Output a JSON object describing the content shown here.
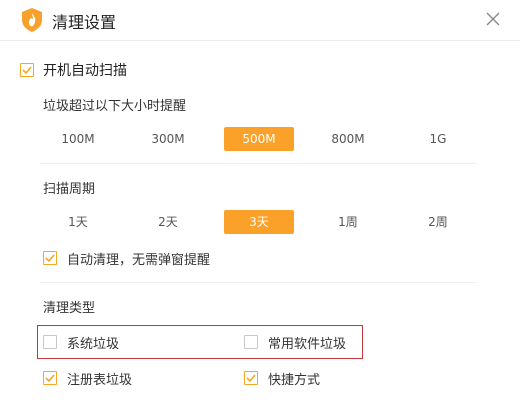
{
  "window": {
    "title": "清理设置",
    "logo_icon": "shield-logo-icon",
    "close_icon": "close-icon"
  },
  "colors": {
    "accent": "#fba129",
    "highlight_border": "#c6343b"
  },
  "auto_scan": {
    "label": "开机自动扫描",
    "checked": true
  },
  "size_threshold": {
    "title": "垃圾超过以下大小时提醒",
    "options": [
      "100M",
      "300M",
      "500M",
      "800M",
      "1G"
    ],
    "selected": "500M"
  },
  "scan_cycle": {
    "title": "扫描周期",
    "options": [
      "1天",
      "2天",
      "3天",
      "1周",
      "2周"
    ],
    "selected": "3天"
  },
  "auto_clean": {
    "label": "自动清理，无需弹窗提醒",
    "checked": true
  },
  "clean_types": {
    "title": "清理类型",
    "items": [
      {
        "label": "系统垃圾",
        "checked": false
      },
      {
        "label": "常用软件垃圾",
        "checked": false
      },
      {
        "label": "注册表垃圾",
        "checked": true
      },
      {
        "label": "快捷方式",
        "checked": true
      }
    ]
  }
}
